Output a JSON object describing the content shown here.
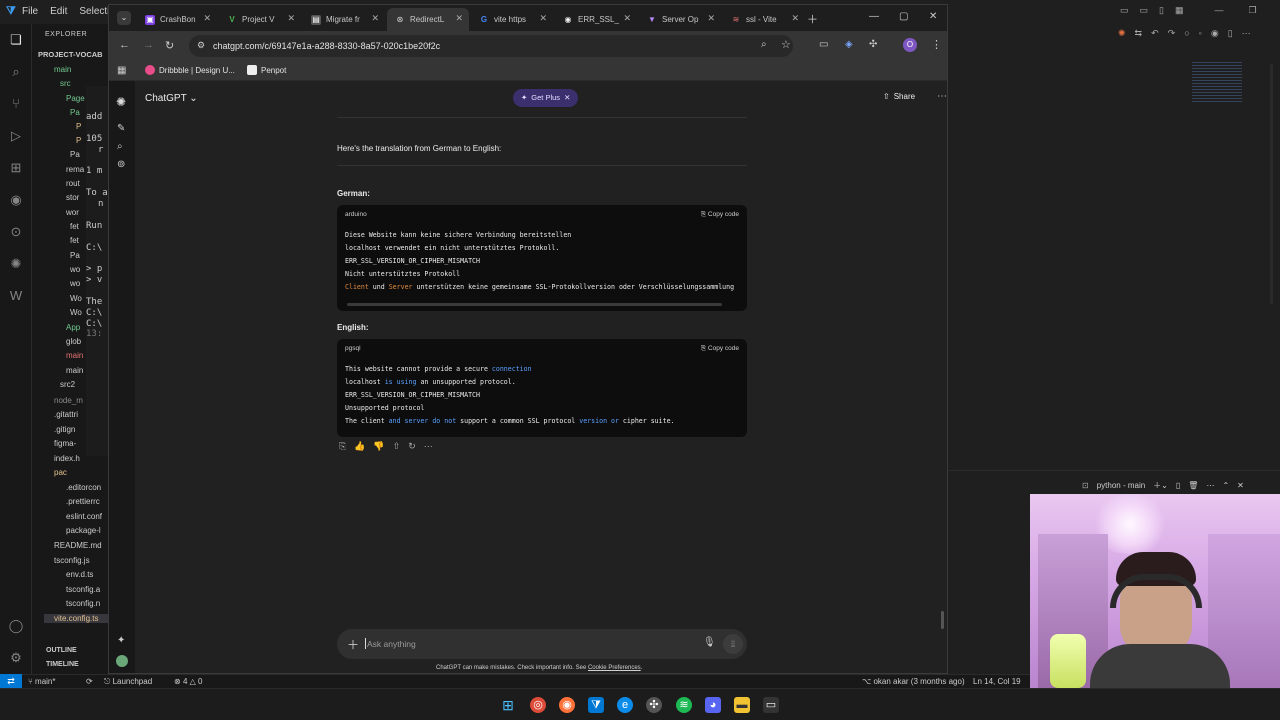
{
  "vscode": {
    "menu": [
      "File",
      "Edit",
      "Selectio"
    ],
    "explorer_title": "EXPLORER",
    "project": "PROJECT-VOCAB",
    "tree": [
      "main",
      "src",
      "Page",
      "Pa",
      "P",
      "P",
      "Pa",
      "rema",
      "rout",
      "stor",
      "wor",
      "fet",
      "fet",
      "Pa",
      "wo",
      "wo",
      "Wo",
      "Wo",
      "App",
      "glob",
      "main",
      "main",
      "src2",
      "node_m",
      ".gitattri",
      ".gitign",
      "figma-",
      "index.h",
      "pac",
      ".editorcon",
      ".prettierrc",
      "eslint.conf",
      "package-l",
      "README.md",
      "tsconfig.js",
      "env.d.ts",
      "tsconfig.a",
      "tsconfig.n",
      "vite.config.ts"
    ],
    "outline": "OUTLINE",
    "timeline": "TIMELINE",
    "terminal_peek": [
      "add",
      "105",
      "r",
      "1 m",
      "To a",
      "n",
      "Run",
      "C:\\",
      "> p",
      "> v",
      "The",
      "C:\\",
      "C:\\",
      "13:"
    ],
    "terminal_title": "python - main",
    "status": {
      "branch": "main*",
      "launchpad": "Launchpad",
      "problems": "4",
      "warnings": "0",
      "blame": "okan akar (3 months ago)",
      "position": "Ln 14, Col 19"
    }
  },
  "chrome": {
    "tabs": [
      {
        "title": "CrashBon",
        "color": "#7b3fe4"
      },
      {
        "title": "Project V",
        "color": "#2e7d32"
      },
      {
        "title": "Migrate fr",
        "color": "#c62828"
      },
      {
        "title": "RedirectL",
        "color": "#9e9e9e"
      },
      {
        "title": "vite https",
        "color": "#ffffff"
      },
      {
        "title": "ERR_SSL_",
        "color": "#ffffff"
      },
      {
        "title": "Server Op",
        "color": "#8e44ad"
      },
      {
        "title": "ssl - Vite",
        "color": "#c0392b"
      }
    ],
    "url": "chatgpt.com/c/69147e1a-a288-8330-8a57-020c1be20f2c",
    "profile_initial": "O",
    "bookmarks": [
      {
        "label": "Dribbble | Design U...",
        "color": "#ea4c89"
      },
      {
        "label": "Penpot",
        "color": "#333333"
      }
    ]
  },
  "chatgpt": {
    "model": "ChatGPT",
    "get_plus": "Get Plus",
    "share": "Share",
    "intro": "Here's the translation from German to English:",
    "german_heading": "German:",
    "german_lang": "arduino",
    "german_lines": [
      "Diese Website kann keine sichere Verbindung bereitstellen",
      "localhost verwendet ein nicht unterstütztes Protokoll.",
      "ERR_SSL_VERSION_OR_CIPHER_MISMATCH",
      "Nicht unterstütztes Protokoll"
    ],
    "german_last": {
      "w1": "Client",
      "w2": " und ",
      "w3": "Server",
      "rest": " unterstützen keine gemeinsame SSL-Protokollversion oder Verschlüsselungssammlung"
    },
    "english_heading": "English:",
    "english_lang": "pgsql",
    "english_lines": {
      "l1a": "This website cannot provide a secure ",
      "l1b": "connection",
      "l2a": "localhost ",
      "l2b": "is using",
      "l2c": " an unsupported protocol.",
      "l3": "ERR_SSL_VERSION_OR_CIPHER_MISMATCH",
      "l4": "Unsupported protocol",
      "l5a": "The client ",
      "l5b": "and server do not",
      "l5c": " support a common SSL protocol ",
      "l5d": "version or",
      "l5e": " cipher suite."
    },
    "copy_label": "Copy code",
    "placeholder": "Ask anything",
    "disclaimer": "ChatGPT can make mistakes. Check important info. See ",
    "disclaimer_link": "Cookie Preferences",
    "disclaimer_end": "."
  }
}
